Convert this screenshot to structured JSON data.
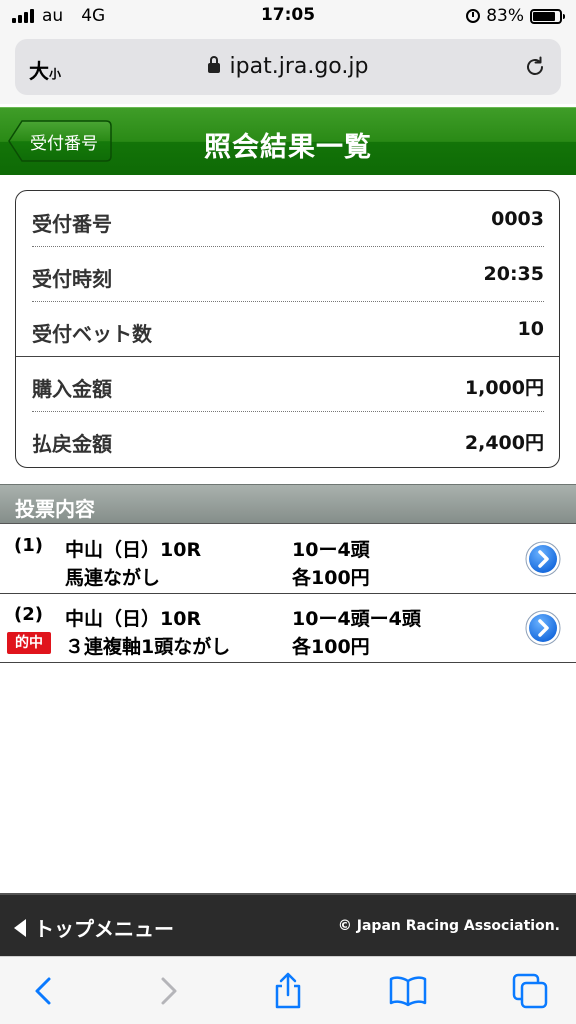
{
  "status_bar": {
    "carrier": "au",
    "network": "4G",
    "time": "17:05",
    "battery": "83%",
    "battery_level": 0.83
  },
  "browser": {
    "text_size_label_large": "大",
    "text_size_label_small": "小",
    "url": "ipat.jra.go.jp"
  },
  "header": {
    "back_label": "受付番号",
    "title": "照会結果一覧"
  },
  "summary": {
    "rows": [
      {
        "label": "受付番号",
        "value": "0003"
      },
      {
        "label": "受付時刻",
        "value": "20:35"
      },
      {
        "label": "受付ベット数",
        "value": "10"
      },
      {
        "label": "購入金額",
        "value": "1,000円"
      },
      {
        "label": "払戻金額",
        "value": "2,400円"
      }
    ]
  },
  "bets": {
    "section_title": "投票内容",
    "items": [
      {
        "number": "(1)",
        "race": "中山（日）10R",
        "type": "馬連ながし",
        "combination": "10ー4頭",
        "amount": "各100円",
        "badge": ""
      },
      {
        "number": "(2)",
        "race": "中山（日）10R",
        "type": "３連複軸1頭ながし",
        "combination": "10ー4頭ー4頭",
        "amount": "各100円",
        "badge": "的中"
      }
    ]
  },
  "footer": {
    "top_menu": "トップメニュー",
    "copyright": "© Japan Racing Association."
  },
  "colors": {
    "header_green": "#137408",
    "hit_red": "#e0141c",
    "ios_blue": "#0a7aff"
  }
}
